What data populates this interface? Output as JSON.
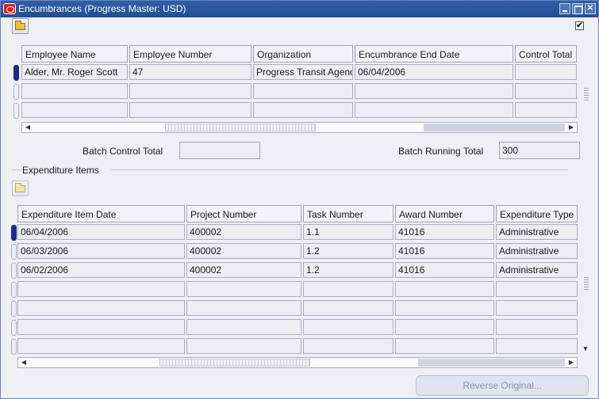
{
  "window": {
    "title": "Encumbrances (Progress Master: USD)",
    "controls": {
      "minimize_icon": "minimize-icon",
      "maximize_icon": "maximize-icon",
      "close_label": "✕"
    }
  },
  "header_checkbox": {
    "checked_mark": "✔"
  },
  "encumbrance_table": {
    "columns": [
      "Employee Name",
      "Employee Number",
      "Organization",
      "Encumbrance End Date",
      "Control Total"
    ],
    "rows": [
      [
        "Alder, Mr. Roger Scott",
        "47",
        "Progress Transit Agency",
        "06/04/2006",
        ""
      ],
      [
        "",
        "",
        "",
        "",
        ""
      ],
      [
        "",
        "",
        "",
        "",
        ""
      ]
    ]
  },
  "batch": {
    "control_total_label": "Batch Control Total",
    "control_total_value": "",
    "running_total_label": "Batch Running Total",
    "running_total_value": "300"
  },
  "expenditure": {
    "section_title": "Expenditure Items",
    "columns": [
      "Expenditure Item Date",
      "Project Number",
      "Task Number",
      "Award Number",
      "Expenditure Type"
    ],
    "rows": [
      [
        "06/04/2006",
        "400002",
        "1.1",
        "41016",
        "Administrative"
      ],
      [
        "06/03/2006",
        "400002",
        "1.2",
        "41016",
        "Administrative"
      ],
      [
        "06/02/2006",
        "400002",
        "1.2",
        "41016",
        "Administrative"
      ],
      [
        "",
        "",
        "",
        "",
        ""
      ],
      [
        "",
        "",
        "",
        "",
        ""
      ],
      [
        "",
        "",
        "",
        "",
        ""
      ],
      [
        "",
        "",
        "",
        "",
        ""
      ]
    ]
  },
  "footer": {
    "reverse_button_label": "Reverse Original..."
  },
  "colors": {
    "title_bar": "#2f5fa7",
    "active_row_indicator": "#1c2a8c",
    "window_bg": "#eef0f5"
  }
}
